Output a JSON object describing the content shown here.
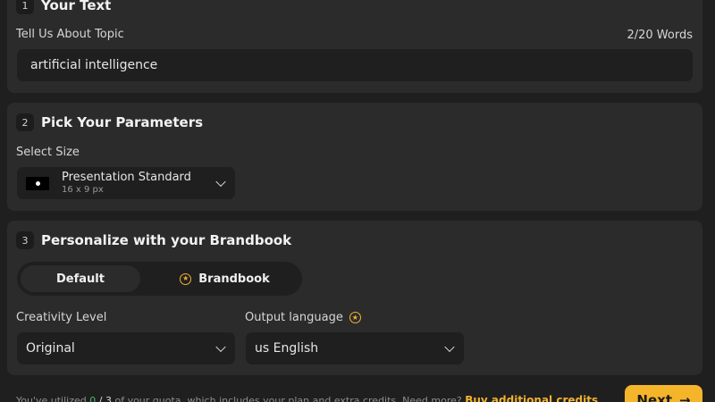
{
  "sections": {
    "text": {
      "number": "1",
      "title": "Your Text",
      "topic_label": "Tell Us About Topic",
      "word_count": "2/20 Words",
      "topic_value": "artificial intelligence"
    },
    "parameters": {
      "number": "2",
      "title": "Pick Your Parameters",
      "size_label": "Select Size",
      "size_name": "Presentation Standard",
      "size_dims": "16 x 9 px"
    },
    "brandbook": {
      "number": "3",
      "title": "Personalize with your Brandbook",
      "toggle_default": "Default",
      "toggle_brandbook": "Brandbook",
      "creativity_label": "Creativity Level",
      "creativity_value": "Original",
      "language_label": "Output language",
      "language_value": "us English"
    }
  },
  "footer": {
    "quota_prefix": "You've utilized",
    "quota_used": "0",
    "quota_sep": "/",
    "quota_total": "3",
    "quota_suffix": "of your quota, which includes your plan and extra credits. Need more?",
    "buy_link": "Buy additional credits",
    "next_label": "Next",
    "next_arrow": "→"
  },
  "colors": {
    "accent": "#f5b52b",
    "panel": "#2b2b2b",
    "background": "#1f1f1f",
    "quota_used": "#4fb36a"
  },
  "icons": [
    "star-icon",
    "chevron-down-icon",
    "arrow-right-icon"
  ]
}
